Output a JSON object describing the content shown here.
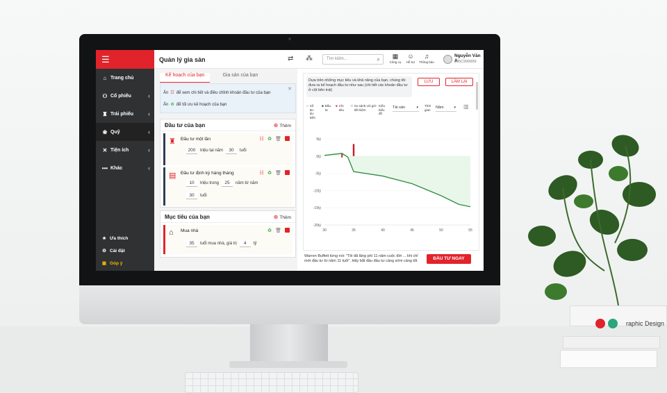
{
  "app": {
    "title": "Quản lý gia sản"
  },
  "search": {
    "placeholder": "Tìm kiếm..."
  },
  "topnav": [
    {
      "label": "Công cụ",
      "icon": "tools-icon"
    },
    {
      "label": "Hỗ trợ",
      "icon": "support-icon"
    },
    {
      "label": "Thông báo",
      "icon": "bell-icon"
    }
  ],
  "user": {
    "name": "Nguyễn Văn A",
    "id": "105C999999"
  },
  "sidebar": {
    "items": [
      {
        "label": "Trang chủ",
        "icon": "home-icon"
      },
      {
        "label": "Cổ phiếu",
        "icon": "stock-icon"
      },
      {
        "label": "Trái phiếu",
        "icon": "bond-icon"
      },
      {
        "label": "Quỹ",
        "icon": "fund-icon"
      },
      {
        "label": "Tiện ích",
        "icon": "utility-icon"
      },
      {
        "label": "Khác",
        "icon": "more-icon"
      }
    ],
    "bottom": [
      {
        "label": "Ưa thích",
        "icon": "star-icon"
      },
      {
        "label": "Cài đặt",
        "icon": "gear-icon"
      },
      {
        "label": "Góp ý",
        "icon": "feedback-icon"
      }
    ]
  },
  "tabs": [
    "Kế hoạch của bạn",
    "Gia sản của bạn"
  ],
  "notice": {
    "row1_prefix": "Ấn",
    "row1_text": "để xem chi tiết và điều chỉnh khoản đầu tư của bạn",
    "row2_prefix": "Ấn",
    "row2_text": "để tối ưu kế hoạch của bạn"
  },
  "invest": {
    "title": "Đầu tư của bạn",
    "add_label": "Thêm",
    "lump": {
      "name": "Đầu tư một lần",
      "amount": "200",
      "unit_text": "triệu tại năm",
      "age": "30",
      "age_unit": "tuổi"
    },
    "periodic": {
      "name": "Đầu tư định kỳ hàng tháng",
      "amount": "10",
      "unit_text": "triệu trong",
      "years": "25",
      "years_text": "năm từ năm",
      "age": "30",
      "age_unit": "tuổi"
    }
  },
  "goals": {
    "title": "Mục tiêu của bạn",
    "add_label": "Thêm",
    "house": {
      "name": "Mua nhà",
      "age": "35",
      "text": "tuổi mua nhà, giá trị",
      "value": "4",
      "unit": "tỷ"
    }
  },
  "right": {
    "description": "Dựa trên những mục tiêu và khả năng của bạn, chúng tôi đưa ra kế hoạch đầu tư như sau (chi tiết các khoản đầu tư ở cột bên trái)",
    "save_label": "LƯU",
    "reset_label": "LÀM LẠI",
    "legend": {
      "l1": "Số dư dự kiến",
      "l2": "Đầu tư",
      "l3": "Chi tiêu",
      "l4": "So sánh với gửi tiết kiệm",
      "l5": "Kiểu biểu đồ",
      "select1": "Tài sản",
      "l6": "Thời gian",
      "select2": "Năm"
    },
    "quote": "Warren Buffett từng nói: \"Tôi đã lãng phí 11 năm cuộc đời ... khi chỉ mới đầu tư từ năm 11 tuổi\". Hãy bắt đầu đầu tư càng sớm càng tốt",
    "cta_label": "ĐẦU TƯ NGAY"
  },
  "colors": {
    "accent": "#e1232c",
    "sidebar": "#2f3133",
    "line": "#2e8b3e",
    "area": "#e8f7ea"
  },
  "chart_data": {
    "type": "line",
    "y_ticks": [
      "5tỷ",
      "0tỷ",
      "-5tỷ",
      "-10tỷ",
      "-15tỷ",
      "-20tỷ"
    ],
    "x_ticks": [
      "30",
      "35",
      "40",
      "45",
      "50",
      "55"
    ],
    "ylim": [
      -20,
      5
    ],
    "xlim": [
      30,
      55
    ],
    "series": [
      {
        "x": [
          30,
          33,
          34,
          35,
          40,
          45,
          50,
          53,
          55
        ],
        "y": [
          0.2,
          0.8,
          -0.3,
          -4.5,
          -5.8,
          -8.0,
          -11.5,
          -14.0,
          -14.7
        ]
      }
    ],
    "bars_invest": [
      {
        "x": 33,
        "y": 0.8
      }
    ],
    "bars_spend": [
      {
        "x": 35,
        "y": 3.5
      }
    ],
    "comparison_area": {
      "x_from": 35,
      "x_to": 55,
      "y_top": 0
    }
  }
}
